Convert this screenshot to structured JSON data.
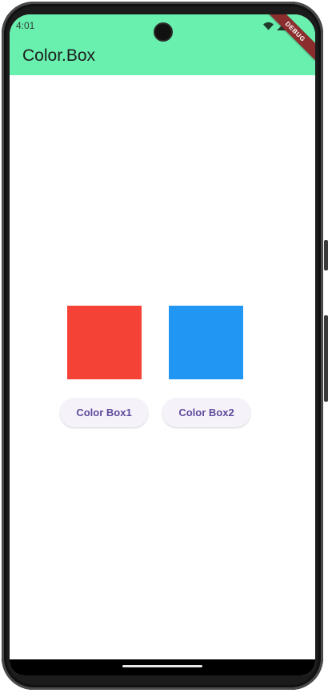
{
  "status_bar": {
    "time": "4:01"
  },
  "app_bar": {
    "title": "Color.Box",
    "debug_banner": "DEBUG"
  },
  "boxes": [
    {
      "color": "#f44336"
    },
    {
      "color": "#2196f3"
    }
  ],
  "buttons": {
    "box1_label": "Color Box1",
    "box2_label": "Color Box2"
  },
  "colors": {
    "app_bar_bg": "#69f0ae",
    "button_text": "#5e4b9c",
    "debug_banner_bg": "#8b2d2d"
  },
  "icons": [
    "wifi-icon",
    "signal-icon",
    "battery-icon"
  ]
}
